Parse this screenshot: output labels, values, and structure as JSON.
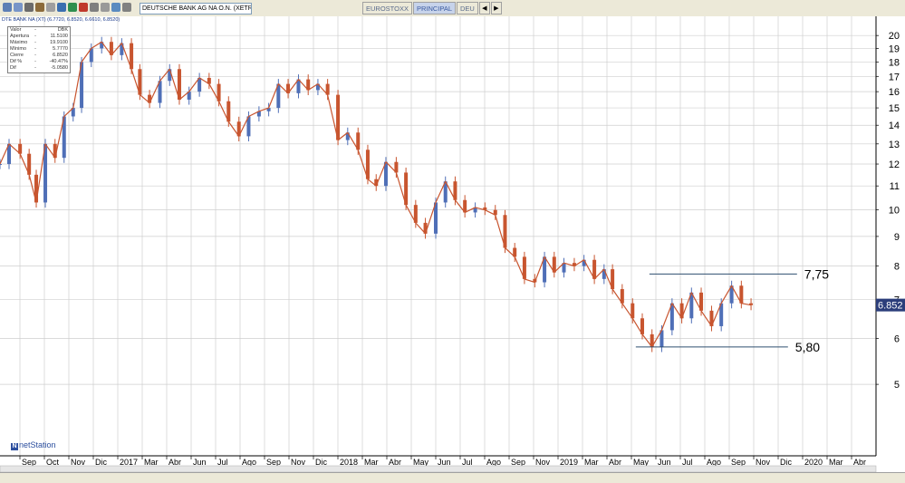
{
  "toolbar": {
    "symbol": "DEUTSCHE BANK AG NA O.N. (XETRA)",
    "tabs": [
      "EUROSTOXX",
      "PRINCIPAL",
      "DEU"
    ],
    "active_tab": "PRINCIPAL"
  },
  "info_panel": {
    "header": "DTE BANK NA (XT) (6.7720, 6.8520, 6.6610, 6.8520)",
    "rows": [
      {
        "label": "Valor",
        "value": "DBK"
      },
      {
        "label": "Apertura",
        "value": "11.5100"
      },
      {
        "label": "Máximo",
        "value": "19.9100"
      },
      {
        "label": "Mínimo",
        "value": "5.7770"
      },
      {
        "label": "Cierre",
        "value": "6.8520"
      },
      {
        "label": "Dif %",
        "value": "-40.47%"
      },
      {
        "label": "Dif",
        "value": "-5.0580"
      }
    ]
  },
  "logo": "netStation",
  "colors": {
    "up": "#4f6fb7",
    "down": "#c8552f",
    "grid": "#cfcfcf",
    "line": "#2f4f6f",
    "badge": "#2b3d7a"
  },
  "chart_data": {
    "type": "line",
    "subtype": "candlestick",
    "yscale": "log",
    "ylim": [
      4.3,
      21.2
    ],
    "yticks": [
      5,
      6,
      7,
      8,
      9,
      10,
      11,
      12,
      13,
      14,
      15,
      16,
      17,
      18,
      19,
      20
    ],
    "x_labels": [
      "Sep",
      "Oct",
      "Nov",
      "Dic",
      "2017",
      "Mar",
      "Abr",
      "Jun",
      "Jul",
      "Ago",
      "Sep",
      "Nov",
      "Dic",
      "2018",
      "Mar",
      "Abr",
      "May",
      "Jun",
      "Jul",
      "Ago",
      "Sep",
      "Nov",
      "2019",
      "Mar",
      "Abr",
      "May",
      "Jun",
      "Jul",
      "Ago",
      "Sep",
      "Nov",
      "Dic",
      "2020",
      "Mar",
      "Abr"
    ],
    "last_value": "6.852",
    "series": [
      {
        "x": [
          "2016-08-01",
          "2016-08-15",
          "2016-09-01",
          "2016-09-15",
          "2016-09-26",
          "2016-10-10",
          "2016-10-25",
          "2016-11-08",
          "2016-11-22",
          "2016-12-05",
          "2016-12-20",
          "2017-01-05",
          "2017-01-20",
          "2017-02-05",
          "2017-02-20",
          "2017-03-05",
          "2017-03-20",
          "2017-04-05",
          "2017-04-20",
          "2017-05-05",
          "2017-05-20",
          "2017-06-05",
          "2017-06-20",
          "2017-07-05",
          "2017-07-20",
          "2017-08-05",
          "2017-08-20",
          "2017-09-05",
          "2017-09-20",
          "2017-10-05",
          "2017-10-20",
          "2017-11-05",
          "2017-11-20",
          "2017-12-05",
          "2017-12-20",
          "2018-01-05",
          "2018-01-20",
          "2018-02-05",
          "2018-02-20",
          "2018-03-05",
          "2018-03-20",
          "2018-04-05",
          "2018-04-20",
          "2018-05-05",
          "2018-05-20",
          "2018-06-05",
          "2018-06-20",
          "2018-07-05",
          "2018-07-20",
          "2018-08-05",
          "2018-08-20",
          "2018-09-05",
          "2018-09-20",
          "2018-10-05",
          "2018-10-20",
          "2018-11-05",
          "2018-11-20",
          "2018-12-05",
          "2018-12-20",
          "2019-01-05",
          "2019-01-20",
          "2019-02-05",
          "2019-02-20",
          "2019-03-05",
          "2019-03-20",
          "2019-04-05",
          "2019-04-20",
          "2019-05-05",
          "2019-05-20",
          "2019-06-05",
          "2019-06-20",
          "2019-07-05",
          "2019-07-20",
          "2019-08-05",
          "2019-08-20",
          "2019-09-05",
          "2019-09-20",
          "2019-10-05"
        ],
        "values": [
          12.0,
          13.0,
          12.5,
          11.5,
          10.3,
          13.0,
          12.3,
          14.5,
          15.0,
          18.0,
          19.0,
          19.5,
          18.5,
          19.4,
          17.5,
          15.8,
          15.3,
          16.7,
          17.5,
          15.5,
          16.0,
          16.9,
          16.5,
          15.4,
          14.2,
          13.4,
          14.5,
          14.8,
          15.0,
          16.5,
          15.9,
          16.8,
          16.1,
          16.5,
          15.8,
          13.2,
          13.6,
          12.7,
          11.3,
          11.0,
          12.1,
          11.6,
          10.2,
          9.5,
          9.1,
          10.3,
          11.2,
          10.4,
          9.9,
          10.1,
          10.0,
          9.8,
          8.6,
          8.3,
          7.6,
          7.5,
          8.3,
          7.8,
          8.1,
          8.0,
          8.2,
          7.6,
          7.9,
          7.3,
          6.9,
          6.5,
          6.1,
          5.8,
          6.2,
          6.9,
          6.5,
          7.2,
          6.7,
          6.3,
          6.9,
          7.4,
          6.9,
          6.85
        ]
      }
    ],
    "annotations": [
      {
        "text": "7,75",
        "value": 7.75,
        "x_from": "2019-05-01",
        "x_to": "2019-12-15"
      },
      {
        "text": "5,80",
        "value": 5.8,
        "x_from": "2019-04-10",
        "x_to": "2019-12-01"
      }
    ]
  }
}
